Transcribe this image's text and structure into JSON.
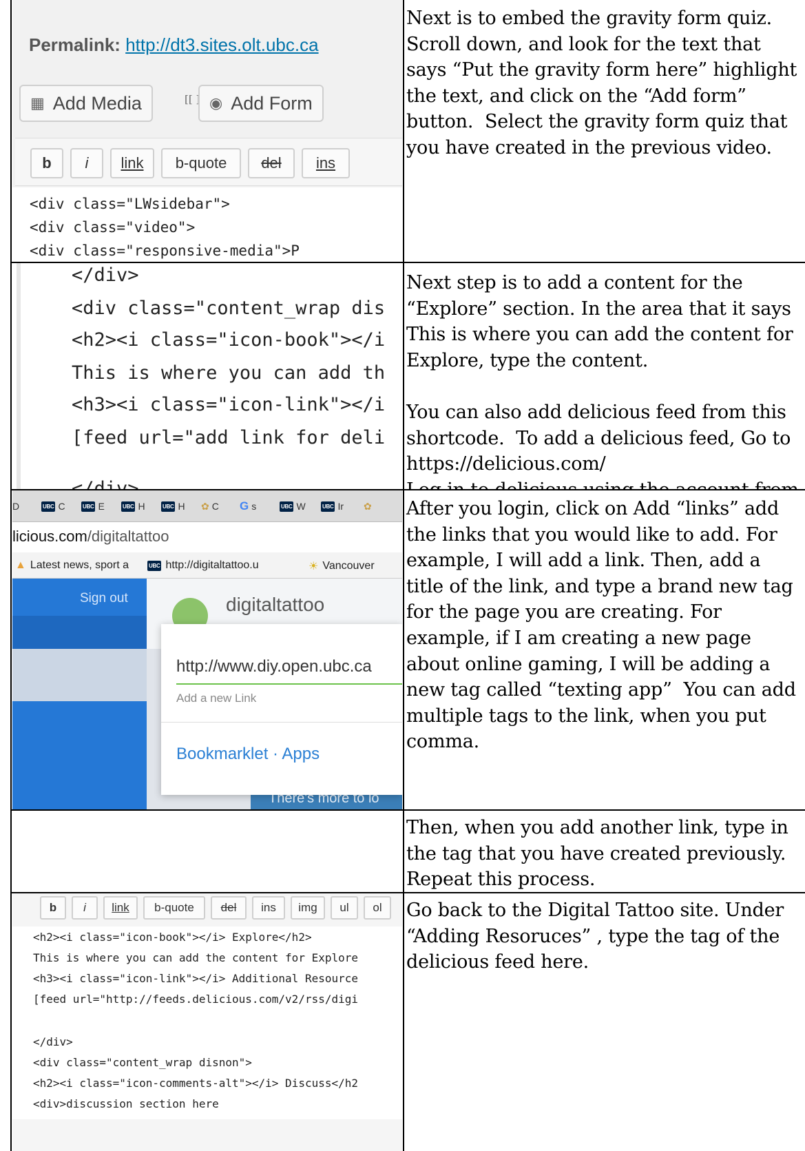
{
  "rows": [
    {
      "instructions": "Next is to embed the gravity form quiz. Scroll down, and look for the text that says “Put the gravity form here” highlight the text, and click on the “Add form” button.  Select the gravity form quiz that you have created in the previous video.",
      "screenshot": {
        "permalink_label": "Permalink:",
        "permalink_url": "http://dt3.sites.olt.ubc.ca",
        "add_media_label": "Add Media",
        "brackets": "[[ ]]",
        "add_form_label": "Add Form",
        "quicktags": [
          "b",
          "i",
          "link",
          "b-quote",
          "del",
          "ins"
        ],
        "code_lines": [
          "<div class=\"LWsidebar\">",
          "<div class=\"video\">",
          "<div class=\"responsive-media\">P"
        ]
      }
    },
    {
      "instructions": "Next step is to add a content for the “Explore” section. In the area that it says This is where you can add the content for Explore, type the content.\n\nYou can also add delicious feed from this shortcode.  To add a delicious feed, Go to https://delicious.com/\nLog in to delicious using the account from Digital Tattoo.",
      "screenshot": {
        "code_lines": [
          "</div>",
          "<div class=\"content_wrap dis",
          "<h2><i class=\"icon-book\"></i",
          "This is where you can add th",
          "<h3><i class=\"icon-link\"></i",
          "[feed url=\"add link for deli",
          "",
          "</div>"
        ]
      }
    },
    {
      "instructions": "After you login, click on Add “links” add the links that you would like to add. For example, I will add a link. Then, add a title of the link, and type a brand new tag for the page you are creating. For example, if I am creating a new page about online gaming, I will be adding a new tag called “texting app”  You can add multiple tags to the link, when you put comma.",
      "screenshot": {
        "tabs": [
          {
            "badge": "",
            "text": "D"
          },
          {
            "badge": "UBC",
            "text": "C"
          },
          {
            "badge": "UBC",
            "text": "E"
          },
          {
            "badge": "UBC",
            "text": "H"
          },
          {
            "badge": "UBC",
            "text": "H"
          },
          {
            "badge": "",
            "text": "C"
          },
          {
            "badge": "G",
            "text": "s"
          },
          {
            "badge": "UBC",
            "text": "W"
          },
          {
            "badge": "UBC",
            "text": "Ir"
          }
        ],
        "url_prefix": "licious.com",
        "url_path": "/digitaltattoo",
        "bookmarks": [
          "Latest news, sport a",
          "http://digitaltattoo.u",
          "Vancouver"
        ],
        "sign_out": "Sign out",
        "site_name": "digitaltattoo",
        "link_value": "http://www.diy.open.ubc.ca",
        "link_hint": "Add a new Link",
        "footer_links": "Bookmarklet · Apps",
        "banner_text": "There's more to lo"
      }
    },
    {
      "instructions": "Then, when you add another link, type in the tag that you have created previously. Repeat this process."
    },
    {
      "instructions": "Go back to the Digital Tattoo site. Under “Adding Resoruces” , type the tag of the delicious feed here.",
      "screenshot": {
        "quicktags": [
          "b",
          "i",
          "link",
          "b-quote",
          "del",
          "ins",
          "img",
          "ul",
          "ol"
        ],
        "code_lines": [
          "<h2><i class=\"icon-book\"></i> Explore</h2>",
          "This is where you can add the content for Explore",
          "<h3><i class=\"icon-link\"></i> Additional Resource",
          "[feed url=\"http://feeds.delicious.com/v2/rss/digi",
          "",
          "</div>",
          "<div class=\"content_wrap disnon\">",
          "<h2><i class=\"icon-comments-alt\"></i> Discuss</h2",
          "<div>discussion section here"
        ]
      }
    }
  ]
}
